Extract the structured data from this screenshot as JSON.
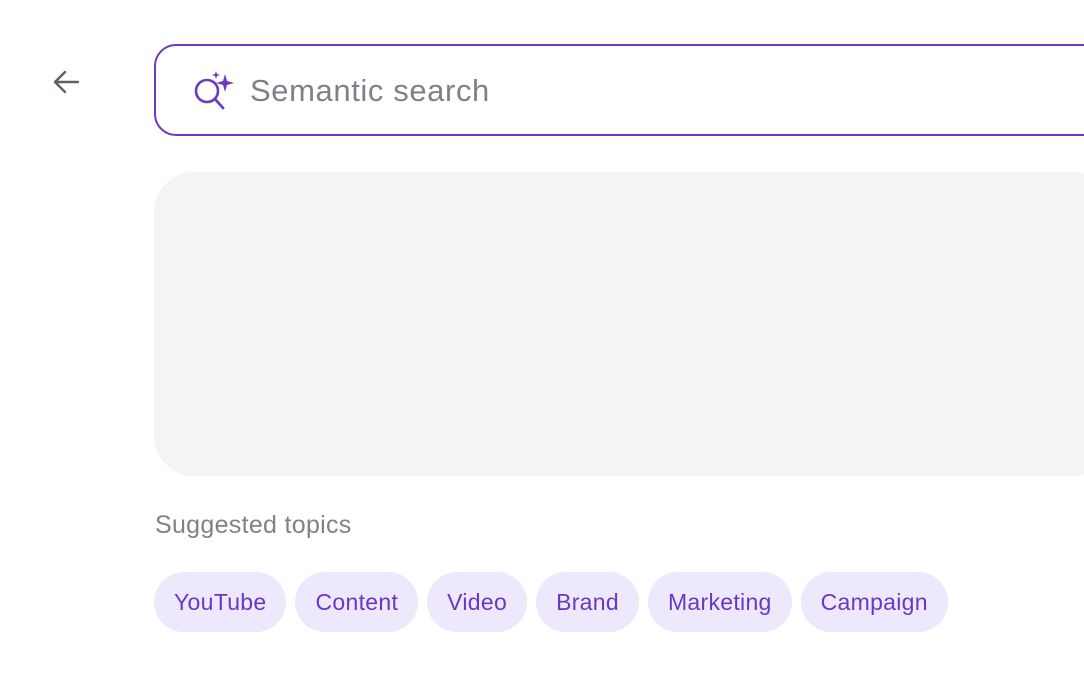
{
  "header": {
    "back_icon": "arrow-left-icon"
  },
  "search": {
    "icon": "magic-search-icon",
    "placeholder": "Semantic search",
    "value": ""
  },
  "suggested": {
    "label": "Suggested topics",
    "topics": [
      {
        "label": "YouTube"
      },
      {
        "label": "Content"
      },
      {
        "label": "Video"
      },
      {
        "label": "Brand"
      },
      {
        "label": "Marketing"
      },
      {
        "label": "Campaign"
      }
    ]
  },
  "colors": {
    "accent": "#6b3bbf",
    "chip_bg": "#ede8fb",
    "chip_text": "#6a38c4",
    "panel_bg": "#f4f4f6",
    "muted_text": "#80828a"
  }
}
